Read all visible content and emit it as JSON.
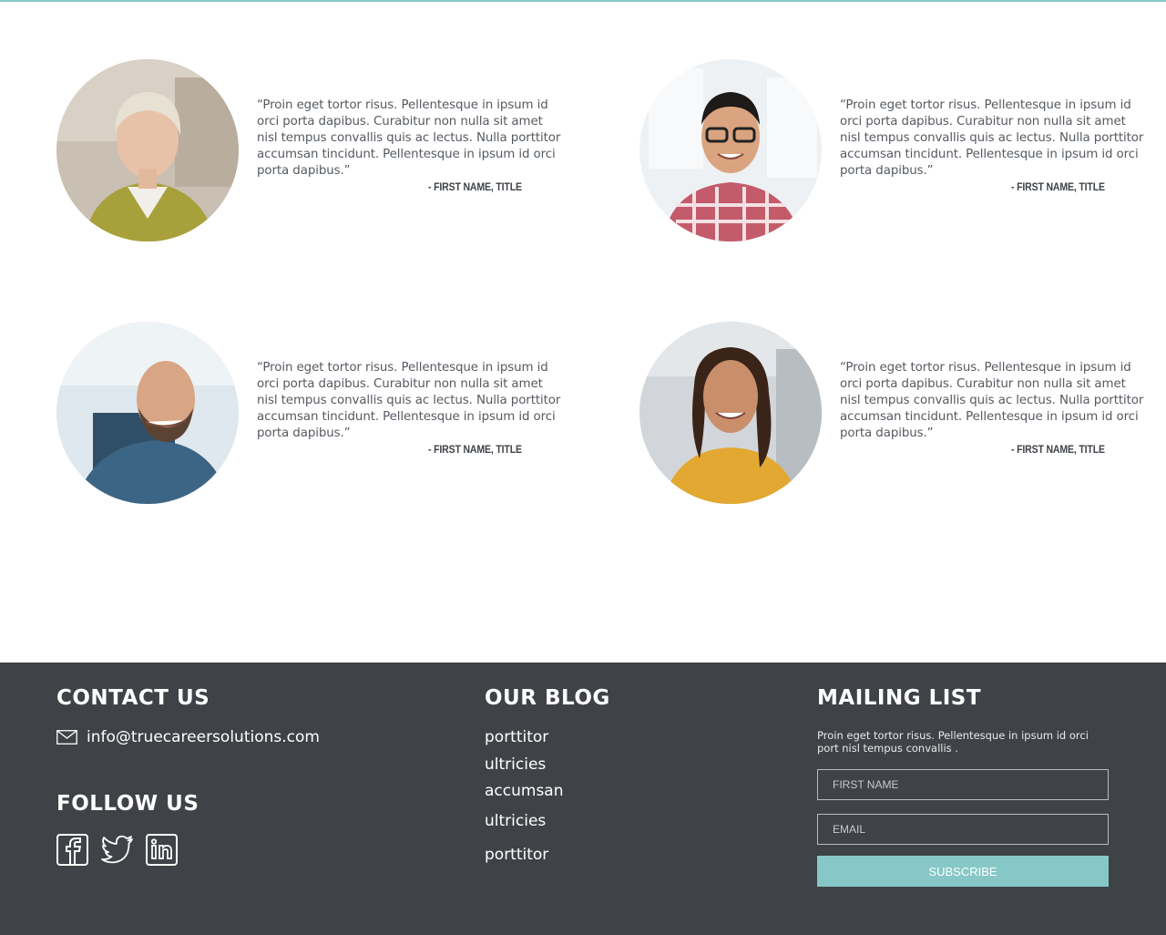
{
  "colors": {
    "accent": "#86c8c7",
    "footer_bg": "#3f4247",
    "text": "#555a60"
  },
  "testimonials": [
    {
      "quote": "“Proin eget tortor risus. Pellentesque in ipsum id orci porta dapibus. Curabitur non nulla sit amet nisl tempus convallis quis ac lectus. Nulla porttitor accumsan tincidunt. Pellentesque in ipsum id orci porta dapibus.”",
      "author": "- FIRST NAME, TITLE"
    },
    {
      "quote": "“Proin eget tortor risus. Pellentesque in ipsum id orci porta dapibus. Curabitur non nulla sit amet nisl tempus convallis quis ac lectus. Nulla porttitor accumsan tincidunt. Pellentesque in ipsum id orci porta dapibus.”",
      "author": "- FIRST NAME, TITLE"
    },
    {
      "quote": "“Proin eget tortor risus. Pellentesque in ipsum id orci porta dapibus. Curabitur non nulla sit amet nisl tempus convallis quis ac lectus. Nulla porttitor accumsan tincidunt. Pellentesque in ipsum id orci porta dapibus.”",
      "author": "- FIRST NAME, TITLE"
    },
    {
      "quote": "“Proin eget tortor risus. Pellentesque in ipsum id orci porta dapibus. Curabitur non nulla sit amet nisl tempus convallis quis ac lectus. Nulla porttitor accumsan tincidunt. Pellentesque in ipsum id orci porta dapibus.”",
      "author": "- FIRST NAME, TITLE"
    }
  ],
  "footer": {
    "contact": {
      "title": "CONTACT US",
      "email": "info@truecareersolutions.com",
      "icon": "envelope-icon"
    },
    "follow": {
      "title": "FOLLOW US",
      "icons": [
        "facebook-icon",
        "twitter-icon",
        "linkedin-icon"
      ]
    },
    "blog": {
      "title": "OUR BLOG",
      "items": [
        "porttitor",
        "ultricies",
        "accumsan",
        "ultricies",
        "porttitor"
      ]
    },
    "mailing": {
      "title": "MAILING LIST",
      "description": "Proin eget tortor risus. Pellentesque in ipsum id orci port nisl tempus convallis .",
      "first_name_placeholder": "FIRST NAME",
      "email_placeholder": "EMAIL",
      "subscribe_label": "SUBSCRIBE"
    }
  }
}
